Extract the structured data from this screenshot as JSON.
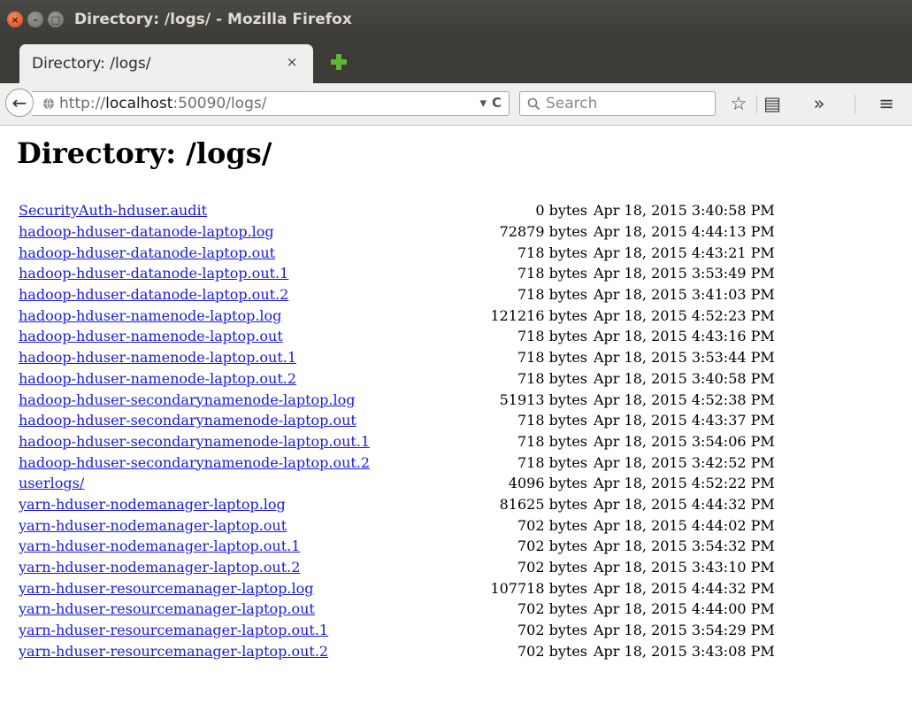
{
  "window": {
    "title": "Directory: /logs/ - Mozilla Firefox",
    "close_glyph": "×",
    "min_glyph": "–",
    "max_glyph": "□"
  },
  "tab": {
    "label": "Directory: /logs/",
    "close_glyph": "×"
  },
  "navbar": {
    "back_glyph": "←",
    "url_prefix": "http://",
    "url_host": "localhost",
    "url_rest": ":50090/logs/",
    "dropdown_glyph": "▾",
    "reload_glyph": "C",
    "search_placeholder": "Search",
    "star_glyph": "☆",
    "bookmarks_glyph": "▤",
    "overflow_glyph": "»",
    "menu_glyph": "≡"
  },
  "page": {
    "heading": "Directory: /logs/",
    "files": [
      {
        "name": "SecurityAuth-hduser.audit",
        "size": "0 bytes",
        "date": "Apr 18, 2015 3:40:58 PM"
      },
      {
        "name": "hadoop-hduser-datanode-laptop.log",
        "size": "72879 bytes",
        "date": "Apr 18, 2015 4:44:13 PM"
      },
      {
        "name": "hadoop-hduser-datanode-laptop.out",
        "size": "718 bytes",
        "date": "Apr 18, 2015 4:43:21 PM"
      },
      {
        "name": "hadoop-hduser-datanode-laptop.out.1",
        "size": "718 bytes",
        "date": "Apr 18, 2015 3:53:49 PM"
      },
      {
        "name": "hadoop-hduser-datanode-laptop.out.2",
        "size": "718 bytes",
        "date": "Apr 18, 2015 3:41:03 PM"
      },
      {
        "name": "hadoop-hduser-namenode-laptop.log",
        "size": "121216 bytes",
        "date": "Apr 18, 2015 4:52:23 PM"
      },
      {
        "name": "hadoop-hduser-namenode-laptop.out",
        "size": "718 bytes",
        "date": "Apr 18, 2015 4:43:16 PM"
      },
      {
        "name": "hadoop-hduser-namenode-laptop.out.1",
        "size": "718 bytes",
        "date": "Apr 18, 2015 3:53:44 PM"
      },
      {
        "name": "hadoop-hduser-namenode-laptop.out.2",
        "size": "718 bytes",
        "date": "Apr 18, 2015 3:40:58 PM"
      },
      {
        "name": "hadoop-hduser-secondarynamenode-laptop.log",
        "size": "51913 bytes",
        "date": "Apr 18, 2015 4:52:38 PM"
      },
      {
        "name": "hadoop-hduser-secondarynamenode-laptop.out",
        "size": "718 bytes",
        "date": "Apr 18, 2015 4:43:37 PM"
      },
      {
        "name": "hadoop-hduser-secondarynamenode-laptop.out.1",
        "size": "718 bytes",
        "date": "Apr 18, 2015 3:54:06 PM"
      },
      {
        "name": "hadoop-hduser-secondarynamenode-laptop.out.2",
        "size": "718 bytes",
        "date": "Apr 18, 2015 3:42:52 PM"
      },
      {
        "name": "userlogs/",
        "size": "4096 bytes",
        "date": "Apr 18, 2015 4:52:22 PM"
      },
      {
        "name": "yarn-hduser-nodemanager-laptop.log",
        "size": "81625 bytes",
        "date": "Apr 18, 2015 4:44:32 PM"
      },
      {
        "name": "yarn-hduser-nodemanager-laptop.out",
        "size": "702 bytes",
        "date": "Apr 18, 2015 4:44:02 PM"
      },
      {
        "name": "yarn-hduser-nodemanager-laptop.out.1",
        "size": "702 bytes",
        "date": "Apr 18, 2015 3:54:32 PM"
      },
      {
        "name": "yarn-hduser-nodemanager-laptop.out.2",
        "size": "702 bytes",
        "date": "Apr 18, 2015 3:43:10 PM"
      },
      {
        "name": "yarn-hduser-resourcemanager-laptop.log",
        "size": "107718 bytes",
        "date": "Apr 18, 2015 4:44:32 PM"
      },
      {
        "name": "yarn-hduser-resourcemanager-laptop.out",
        "size": "702 bytes",
        "date": "Apr 18, 2015 4:44:00 PM"
      },
      {
        "name": "yarn-hduser-resourcemanager-laptop.out.1",
        "size": "702 bytes",
        "date": "Apr 18, 2015 3:54:29 PM"
      },
      {
        "name": "yarn-hduser-resourcemanager-laptop.out.2",
        "size": "702 bytes",
        "date": "Apr 18, 2015 3:43:08 PM"
      }
    ]
  },
  "colors": {
    "link": "#1b1bd8",
    "titlebar": "#3c3b37",
    "close_button": "#de4814",
    "new_tab_plus": "#5fb832"
  },
  "icons": {
    "window_close": "close-icon",
    "new_tab": "plus-icon",
    "url_identity": "globe-icon",
    "search": "search-icon"
  }
}
